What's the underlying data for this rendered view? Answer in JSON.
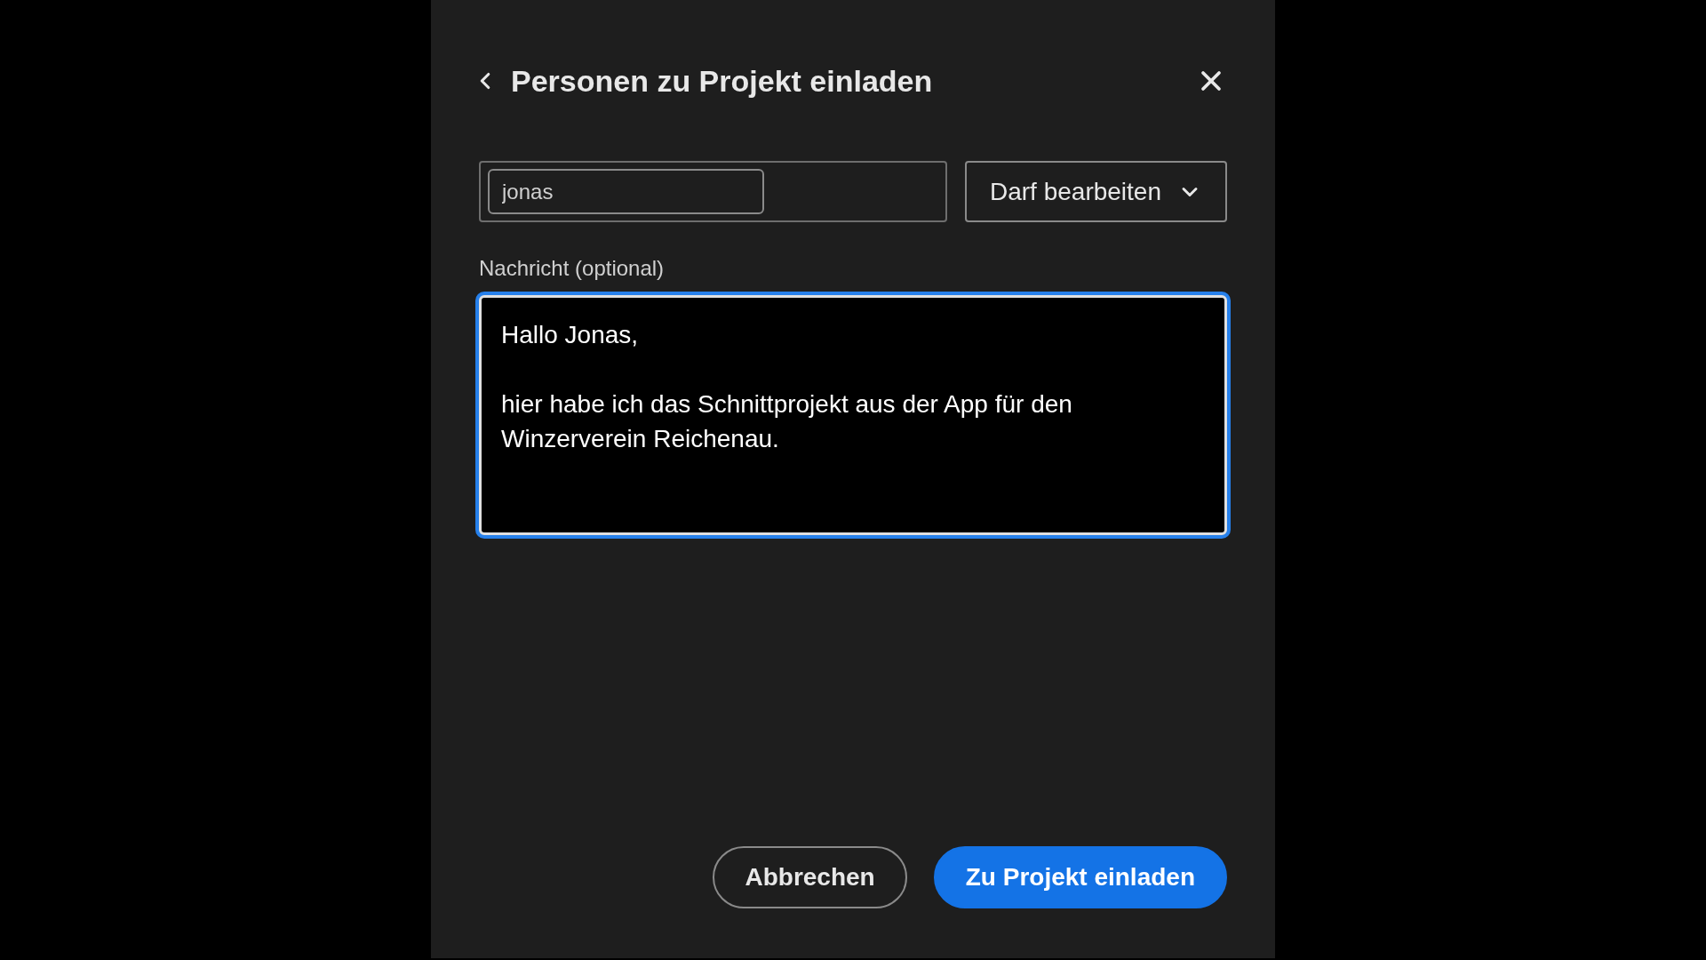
{
  "dialog": {
    "title": "Personen zu Projekt einladen"
  },
  "invitee": {
    "value": "jonas"
  },
  "permission": {
    "value": "Darf bearbeiten"
  },
  "message": {
    "label": "Nachricht (optional)",
    "value": "Hallo Jonas,\n\nhier habe ich das Schnittprojekt aus der App für den Winzerverein Reichenau.",
    "focused": true
  },
  "buttons": [
    {
      "label": "Abbrechen",
      "kind": "secondary"
    },
    {
      "label": "Zu Projekt einladen",
      "kind": "primary"
    }
  ]
}
